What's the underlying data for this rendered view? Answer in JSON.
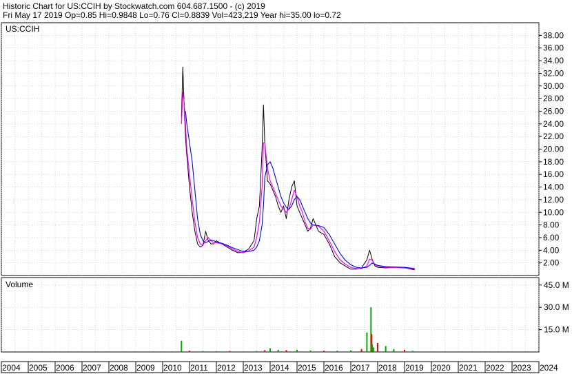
{
  "header": {
    "line1": "Historic Chart for US:CCIH by Stockwatch.com 604.687.1500 - (c) 2019",
    "line2": "Fri May 17 2019   Op=0.85   Hi=0.9848   Lo=0.76   Cl=0.8839   Vol=423,219   Year hi=35.00   lo=0.72"
  },
  "colors": {
    "price": "#000000",
    "ma_short": "#ff00ff",
    "ma_long": "#0000ff",
    "volume_up": "#00aa00",
    "volume_down": "#ff0000",
    "grid": "#c0c0c0"
  },
  "chart_data": {
    "type": "line",
    "ticker_label": "US:CCIH",
    "price_panel": {
      "ylim": [
        0,
        40
      ],
      "yticks": [
        "2.00",
        "4.00",
        "6.00",
        "8.00",
        "10.00",
        "12.00",
        "14.00",
        "16.00",
        "18.00",
        "20.00",
        "22.00",
        "24.00",
        "26.00",
        "28.00",
        "30.00",
        "32.00",
        "34.00",
        "36.00",
        "38.00"
      ],
      "x": [
        2010.7,
        2010.75,
        2010.8,
        2010.85,
        2010.9,
        2011.0,
        2011.1,
        2011.2,
        2011.3,
        2011.4,
        2011.5,
        2011.6,
        2011.7,
        2011.8,
        2011.9,
        2012.0,
        2012.2,
        2012.4,
        2012.6,
        2012.8,
        2013.0,
        2013.2,
        2013.4,
        2013.5,
        2013.6,
        2013.7,
        2013.75,
        2013.8,
        2013.9,
        2014.0,
        2014.1,
        2014.2,
        2014.3,
        2014.4,
        2014.5,
        2014.6,
        2014.7,
        2014.8,
        2014.9,
        2015.0,
        2015.1,
        2015.2,
        2015.3,
        2015.4,
        2015.5,
        2015.6,
        2015.8,
        2016.0,
        2016.2,
        2016.4,
        2016.6,
        2016.8,
        2017.0,
        2017.2,
        2017.4,
        2017.6,
        2017.7,
        2017.8,
        2017.9,
        2018.0,
        2018.3,
        2018.6,
        2019.0,
        2019.38
      ],
      "series": [
        {
          "values": [
            25,
            33,
            27,
            22,
            19,
            14,
            10,
            7,
            5,
            4.5,
            4.8,
            7,
            5.5,
            5,
            5,
            5.5,
            5,
            4.5,
            4,
            3.6,
            3.7,
            4.2,
            5.5,
            9,
            11,
            20,
            27,
            21,
            15,
            14.5,
            13.5,
            12.5,
            11,
            10,
            11,
            9,
            12,
            14,
            15,
            11,
            10,
            9,
            8,
            7,
            7.5,
            9,
            7,
            6.5,
            5,
            3,
            2,
            1.5,
            1,
            1,
            1.2,
            2.5,
            4,
            2.5,
            1.5,
            1.3,
            1.2,
            1.3,
            1.2,
            0.88
          ]
        },
        {
          "values": [
            24,
            29,
            27.5,
            24,
            20,
            16,
            12,
            8.5,
            6,
            5,
            4.8,
            5.5,
            6,
            5.5,
            5.2,
            5.2,
            5,
            4.7,
            4.2,
            3.8,
            3.6,
            3.9,
            4.5,
            6,
            8.5,
            14,
            21,
            21,
            17,
            15,
            14,
            13,
            12,
            11,
            10.5,
            10,
            10.5,
            12,
            13.5,
            12.5,
            11,
            10,
            8.5,
            7.5,
            7.3,
            8,
            7.8,
            7,
            5.5,
            3.8,
            2.5,
            1.8,
            1.3,
            1.1,
            1.1,
            1.5,
            2.6,
            2.4,
            1.7,
            1.4,
            1.3,
            1.3,
            1.2,
            1.0
          ]
        },
        {
          "values": [
            null,
            null,
            null,
            26,
            24,
            21,
            18,
            13.5,
            9,
            6.5,
            5.5,
            5.2,
            5.4,
            5.6,
            5.5,
            5.3,
            5.1,
            4.8,
            4.4,
            4.1,
            3.8,
            3.8,
            4.0,
            4.5,
            5.5,
            8,
            11,
            15.5,
            17.5,
            18,
            17,
            15.5,
            14,
            12.5,
            11.5,
            10.8,
            10.5,
            11,
            12,
            12.5,
            12,
            11,
            10,
            9,
            8.3,
            8,
            7.9,
            7.6,
            6.5,
            5,
            3.5,
            2.4,
            1.7,
            1.3,
            1.2,
            1.3,
            1.6,
            2,
            1.8,
            1.6,
            1.4,
            1.35,
            1.3,
            1.1
          ]
        }
      ]
    },
    "volume_panel": {
      "label": "Volume",
      "ylim": [
        0,
        50
      ],
      "yticks": [
        "15.0 M",
        "30.0 M",
        "45.0 M"
      ],
      "x": [
        2010.7,
        2011.0,
        2011.5,
        2012.0,
        2012.5,
        2013.0,
        2013.5,
        2013.8,
        2014.0,
        2014.3,
        2014.6,
        2015.0,
        2015.5,
        2016.0,
        2016.5,
        2017.0,
        2017.4,
        2017.6,
        2017.75,
        2017.78,
        2017.8,
        2017.85,
        2018.0,
        2018.3,
        2018.6,
        2019.0,
        2019.3
      ],
      "values": [
        7.5,
        0.8,
        0.6,
        0.5,
        0.6,
        0.4,
        0.6,
        1.2,
        2.5,
        1.5,
        1.2,
        1.5,
        1.0,
        0.8,
        0.8,
        1.0,
        2.0,
        13,
        30,
        12,
        5,
        3,
        6,
        4,
        2,
        1.5,
        0.8
      ]
    },
    "x_axis": {
      "xlim": [
        2004,
        2024
      ],
      "tick_labels": [
        "2004",
        "2005",
        "2006",
        "2007",
        "2008",
        "2009",
        "2010",
        "2011",
        "2012",
        "2013",
        "2014",
        "2015",
        "2016",
        "2017",
        "2018",
        "2019",
        "2020",
        "2021",
        "2022",
        "2023",
        "2024"
      ]
    }
  }
}
